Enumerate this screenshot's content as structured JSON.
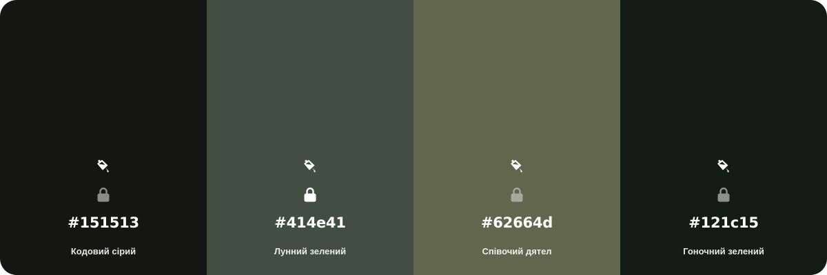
{
  "swatches": [
    {
      "hex": "#151513",
      "name": "Кодовий сірий",
      "background": "#151513",
      "text_color": "#ffffff",
      "name_color": "#e6e6e4",
      "fill_icon": "paint-bucket-icon",
      "fill_icon_color": "#ffffff",
      "lock_icon": "lock-icon",
      "lock_icon_color": "#8a8a86"
    },
    {
      "hex": "#414e41",
      "name": "Лунний зелений",
      "background": "#414e41",
      "text_color": "#ffffff",
      "name_color": "#e9ece9",
      "fill_icon": "paint-bucket-icon",
      "fill_icon_color": "#ffffff",
      "lock_icon": "lock-icon",
      "lock_icon_color": "#ffffff"
    },
    {
      "hex": "#62664d",
      "name": "Співочий дятел",
      "background": "#62664d",
      "text_color": "#ffffff",
      "name_color": "#eeefe9",
      "fill_icon": "paint-bucket-icon",
      "fill_icon_color": "#ffffff",
      "lock_icon": "lock-icon",
      "lock_icon_color": "#a5a89a"
    },
    {
      "hex": "#121c15",
      "name": "Гоночний зелений",
      "background": "#121c15",
      "text_color": "#ffffff",
      "name_color": "#e4e7e5",
      "fill_icon": "paint-bucket-icon",
      "fill_icon_color": "#ffffff",
      "lock_icon": "lock-icon",
      "lock_icon_color": "#8d918e"
    }
  ]
}
